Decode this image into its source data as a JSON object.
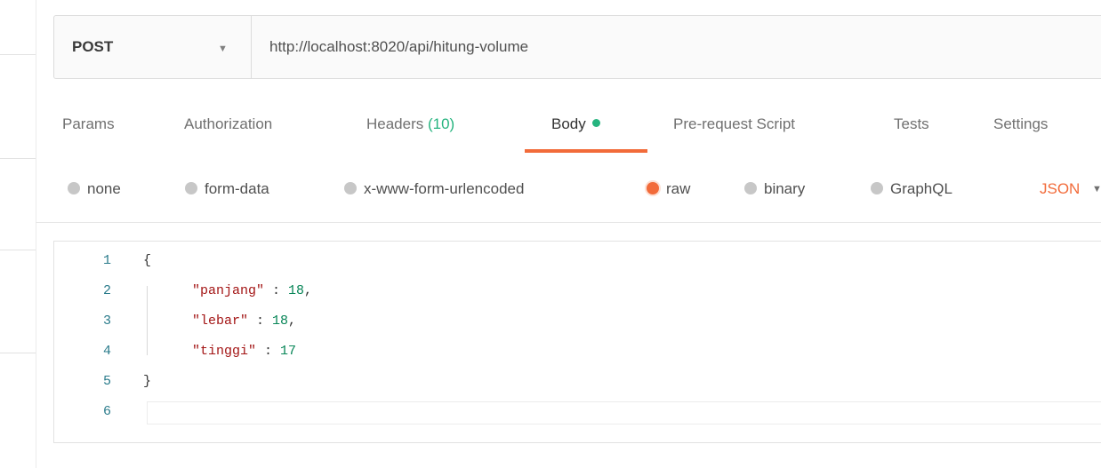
{
  "request": {
    "method": "POST",
    "url": "http://localhost:8020/api/hitung-volume"
  },
  "tabs": [
    {
      "label": "Params"
    },
    {
      "label": "Authorization"
    },
    {
      "label": "Headers ",
      "count": "(10)"
    },
    {
      "label": "Body",
      "active": true
    },
    {
      "label": "Pre-request Script"
    },
    {
      "label": "Tests"
    },
    {
      "label": "Settings"
    }
  ],
  "body_types": [
    {
      "label": "none"
    },
    {
      "label": "form-data"
    },
    {
      "label": "x-www-form-urlencoded"
    },
    {
      "label": "raw",
      "selected": true
    },
    {
      "label": "binary"
    },
    {
      "label": "GraphQL"
    }
  ],
  "language": "JSON",
  "editor": {
    "line_numbers": [
      "1",
      "2",
      "3",
      "4",
      "5",
      "6"
    ],
    "lines": [
      {
        "open": "{"
      },
      {
        "key": "\"panjang\"",
        "sep": " : ",
        "value": "18",
        "tail": ","
      },
      {
        "key": "\"lebar\"",
        "sep": " : ",
        "value": "18",
        "tail": ","
      },
      {
        "key": "\"tinggi\"",
        "sep": " : ",
        "value": "17",
        "tail": ""
      },
      {
        "close": "}"
      },
      {}
    ]
  },
  "colors": {
    "accent": "#f26b3a",
    "green": "#26b47f",
    "json_key": "#a31515",
    "json_number": "#098658"
  }
}
